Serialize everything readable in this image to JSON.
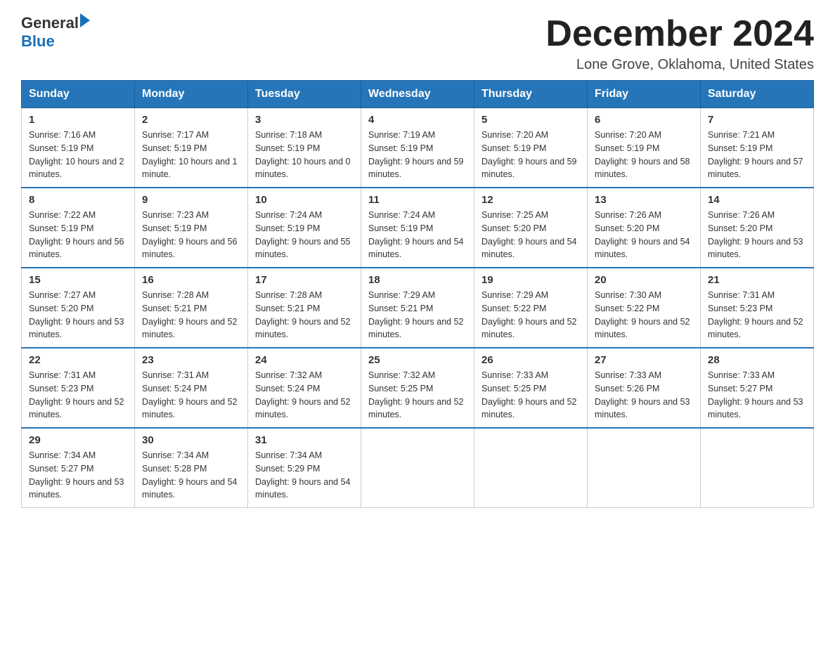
{
  "header": {
    "logo_general": "General",
    "logo_blue": "Blue",
    "month_title": "December 2024",
    "location": "Lone Grove, Oklahoma, United States"
  },
  "weekdays": [
    "Sunday",
    "Monday",
    "Tuesday",
    "Wednesday",
    "Thursday",
    "Friday",
    "Saturday"
  ],
  "weeks": [
    [
      {
        "day": "1",
        "sunrise": "7:16 AM",
        "sunset": "5:19 PM",
        "daylight": "10 hours and 2 minutes."
      },
      {
        "day": "2",
        "sunrise": "7:17 AM",
        "sunset": "5:19 PM",
        "daylight": "10 hours and 1 minute."
      },
      {
        "day": "3",
        "sunrise": "7:18 AM",
        "sunset": "5:19 PM",
        "daylight": "10 hours and 0 minutes."
      },
      {
        "day": "4",
        "sunrise": "7:19 AM",
        "sunset": "5:19 PM",
        "daylight": "9 hours and 59 minutes."
      },
      {
        "day": "5",
        "sunrise": "7:20 AM",
        "sunset": "5:19 PM",
        "daylight": "9 hours and 59 minutes."
      },
      {
        "day": "6",
        "sunrise": "7:20 AM",
        "sunset": "5:19 PM",
        "daylight": "9 hours and 58 minutes."
      },
      {
        "day": "7",
        "sunrise": "7:21 AM",
        "sunset": "5:19 PM",
        "daylight": "9 hours and 57 minutes."
      }
    ],
    [
      {
        "day": "8",
        "sunrise": "7:22 AM",
        "sunset": "5:19 PM",
        "daylight": "9 hours and 56 minutes."
      },
      {
        "day": "9",
        "sunrise": "7:23 AM",
        "sunset": "5:19 PM",
        "daylight": "9 hours and 56 minutes."
      },
      {
        "day": "10",
        "sunrise": "7:24 AM",
        "sunset": "5:19 PM",
        "daylight": "9 hours and 55 minutes."
      },
      {
        "day": "11",
        "sunrise": "7:24 AM",
        "sunset": "5:19 PM",
        "daylight": "9 hours and 54 minutes."
      },
      {
        "day": "12",
        "sunrise": "7:25 AM",
        "sunset": "5:20 PM",
        "daylight": "9 hours and 54 minutes."
      },
      {
        "day": "13",
        "sunrise": "7:26 AM",
        "sunset": "5:20 PM",
        "daylight": "9 hours and 54 minutes."
      },
      {
        "day": "14",
        "sunrise": "7:26 AM",
        "sunset": "5:20 PM",
        "daylight": "9 hours and 53 minutes."
      }
    ],
    [
      {
        "day": "15",
        "sunrise": "7:27 AM",
        "sunset": "5:20 PM",
        "daylight": "9 hours and 53 minutes."
      },
      {
        "day": "16",
        "sunrise": "7:28 AM",
        "sunset": "5:21 PM",
        "daylight": "9 hours and 52 minutes."
      },
      {
        "day": "17",
        "sunrise": "7:28 AM",
        "sunset": "5:21 PM",
        "daylight": "9 hours and 52 minutes."
      },
      {
        "day": "18",
        "sunrise": "7:29 AM",
        "sunset": "5:21 PM",
        "daylight": "9 hours and 52 minutes."
      },
      {
        "day": "19",
        "sunrise": "7:29 AM",
        "sunset": "5:22 PM",
        "daylight": "9 hours and 52 minutes."
      },
      {
        "day": "20",
        "sunrise": "7:30 AM",
        "sunset": "5:22 PM",
        "daylight": "9 hours and 52 minutes."
      },
      {
        "day": "21",
        "sunrise": "7:31 AM",
        "sunset": "5:23 PM",
        "daylight": "9 hours and 52 minutes."
      }
    ],
    [
      {
        "day": "22",
        "sunrise": "7:31 AM",
        "sunset": "5:23 PM",
        "daylight": "9 hours and 52 minutes."
      },
      {
        "day": "23",
        "sunrise": "7:31 AM",
        "sunset": "5:24 PM",
        "daylight": "9 hours and 52 minutes."
      },
      {
        "day": "24",
        "sunrise": "7:32 AM",
        "sunset": "5:24 PM",
        "daylight": "9 hours and 52 minutes."
      },
      {
        "day": "25",
        "sunrise": "7:32 AM",
        "sunset": "5:25 PM",
        "daylight": "9 hours and 52 minutes."
      },
      {
        "day": "26",
        "sunrise": "7:33 AM",
        "sunset": "5:25 PM",
        "daylight": "9 hours and 52 minutes."
      },
      {
        "day": "27",
        "sunrise": "7:33 AM",
        "sunset": "5:26 PM",
        "daylight": "9 hours and 53 minutes."
      },
      {
        "day": "28",
        "sunrise": "7:33 AM",
        "sunset": "5:27 PM",
        "daylight": "9 hours and 53 minutes."
      }
    ],
    [
      {
        "day": "29",
        "sunrise": "7:34 AM",
        "sunset": "5:27 PM",
        "daylight": "9 hours and 53 minutes."
      },
      {
        "day": "30",
        "sunrise": "7:34 AM",
        "sunset": "5:28 PM",
        "daylight": "9 hours and 54 minutes."
      },
      {
        "day": "31",
        "sunrise": "7:34 AM",
        "sunset": "5:29 PM",
        "daylight": "9 hours and 54 minutes."
      },
      null,
      null,
      null,
      null
    ]
  ]
}
